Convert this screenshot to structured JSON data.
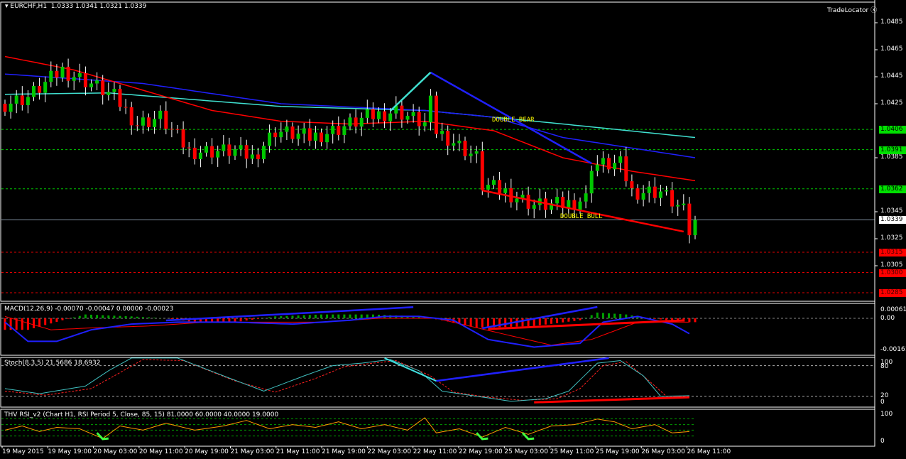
{
  "header": {
    "symbol": "EURCHF,H1",
    "ohlc": "1.0333 1.0341 1.0321 1.0339",
    "brand": "TradeLocator"
  },
  "macd": {
    "title": "MACD(12,26,9) -0.00070 -0.00047 0.00000 -0.00023",
    "ticks": [
      "0.00061",
      "0.00",
      "-0.00161"
    ]
  },
  "stoch": {
    "title": "Stoch(8,3,5) 21.5686 18.6932",
    "ticks": [
      "100",
      "80",
      "20",
      "0"
    ]
  },
  "rsi": {
    "title": "THV RSI_v2  (Chart H1,  RSI Period 5,  Close,  85,  15)  81.0000 60.0000 40.0000 19.0000",
    "ticks": [
      "100",
      "0"
    ]
  },
  "annotations": {
    "bear": "DOUBLE BEAR",
    "bull": "DOUBLE BULL"
  },
  "colors": {
    "up": "#00c800",
    "down": "#ff0000",
    "ma_red": "#ff0000",
    "ma_blue": "#2020ff",
    "ma_cyan": "#40e0d0",
    "support": "#ff0000",
    "resistance": "#00ff00"
  },
  "chart_data": {
    "type": "candlestick",
    "title": "EURCHF,H1",
    "price_ticks": [
      "1.0485",
      "1.0465",
      "1.0445",
      "1.0425",
      "1.0385",
      "1.0345",
      "1.0325",
      "1.0305"
    ],
    "levels": {
      "resistance": [
        "1.0406",
        "1.0391",
        "1.0362"
      ],
      "current": "1.0339",
      "support": [
        "1.0315",
        "1.0300",
        "1.0285"
      ]
    },
    "time_labels": [
      "19 May 2015",
      "19 May 19:00",
      "20 May 03:00",
      "20 May 11:00",
      "20 May 19:00",
      "21 May 03:00",
      "21 May 11:00",
      "21 May 19:00",
      "22 May 03:00",
      "22 May 11:00",
      "22 May 19:00",
      "25 May 03:00",
      "25 May 11:00",
      "25 May 19:00",
      "26 May 03:00",
      "26 May 11:00"
    ],
    "close_path": [
      [
        0,
        1.0425
      ],
      [
        4,
        1.043
      ],
      [
        10,
        1.045
      ],
      [
        15,
        1.044
      ],
      [
        19,
        1.043
      ],
      [
        23,
        1.041
      ],
      [
        27,
        1.0415
      ],
      [
        32,
        1.039
      ],
      [
        40,
        1.039
      ],
      [
        43,
        1.0385
      ],
      [
        47,
        1.0405
      ],
      [
        53,
        1.04
      ],
      [
        57,
        1.0405
      ],
      [
        63,
        1.0415
      ],
      [
        68,
        1.042
      ],
      [
        73,
        1.041
      ],
      [
        74,
        1.0425
      ],
      [
        75,
        1.0405
      ],
      [
        77,
        1.04
      ],
      [
        82,
        1.0385
      ],
      [
        83,
        1.0365
      ],
      [
        87,
        1.036
      ],
      [
        92,
        1.035
      ],
      [
        97,
        1.035
      ],
      [
        101,
        1.0355
      ],
      [
        102,
        1.038
      ],
      [
        107,
        1.038
      ],
      [
        109,
        1.036
      ],
      [
        114,
        1.036
      ],
      [
        118,
        1.0345
      ],
      [
        119,
        1.033
      ],
      [
        120,
        1.0339
      ]
    ],
    "ma_red": [
      [
        0,
        1.046
      ],
      [
        12,
        1.045
      ],
      [
        24,
        1.0435
      ],
      [
        36,
        1.042
      ],
      [
        48,
        1.0412
      ],
      [
        60,
        1.041
      ],
      [
        73,
        1.0412
      ],
      [
        85,
        1.0405
      ],
      [
        97,
        1.0385
      ],
      [
        109,
        1.0375
      ],
      [
        120,
        1.0368
      ]
    ],
    "ma_blue": [
      [
        0,
        1.0447
      ],
      [
        24,
        1.044
      ],
      [
        48,
        1.0425
      ],
      [
        73,
        1.042
      ],
      [
        85,
        1.0415
      ],
      [
        97,
        1.04
      ],
      [
        120,
        1.0385
      ]
    ],
    "ma_cyan": [
      [
        0,
        1.0432
      ],
      [
        18,
        1.0433
      ],
      [
        48,
        1.0423
      ],
      [
        73,
        1.042
      ],
      [
        97,
        1.041
      ],
      [
        120,
        1.04
      ]
    ],
    "trendlines": [
      {
        "color": "#2020ff",
        "from": [
          74,
          1.04482
        ],
        "to": [
          102,
          1.03808
        ]
      },
      {
        "color": "#40e0d0",
        "from": [
          67,
          1.04197
        ],
        "to": [
          74,
          1.04482
        ]
      },
      {
        "color": "#ff0000",
        "from": [
          83,
          1.03608
        ],
        "to": [
          118,
          1.03303
        ]
      },
      {
        "color": "#ff0000",
        "from": [
          83,
          1.0384
        ],
        "to": [
          83,
          1.03608
        ]
      }
    ],
    "macd_main": [
      [
        0,
        -0.0002
      ],
      [
        4,
        -0.0012
      ],
      [
        9,
        -0.0012
      ],
      [
        15,
        -0.0006
      ],
      [
        22,
        -0.0003
      ],
      [
        30,
        -0.0002
      ],
      [
        40,
        -0.0002
      ],
      [
        50,
        -0.0003
      ],
      [
        60,
        -0.0001
      ],
      [
        66,
        0.0001
      ],
      [
        72,
        0.0001
      ],
      [
        78,
        -0.0001
      ],
      [
        84,
        -0.0011
      ],
      [
        92,
        -0.0015
      ],
      [
        100,
        -0.0013
      ],
      [
        104,
        -0.0002
      ],
      [
        110,
        0.0001
      ],
      [
        116,
        -0.0003
      ],
      [
        119,
        -0.0008
      ]
    ],
    "macd_signal": [
      [
        0,
        0.0001
      ],
      [
        8,
        -0.0006
      ],
      [
        15,
        -0.0005
      ],
      [
        25,
        -0.0004
      ],
      [
        35,
        -0.0002
      ],
      [
        45,
        -0.0002
      ],
      [
        55,
        -0.0002
      ],
      [
        65,
        0.0
      ],
      [
        75,
        0.0
      ],
      [
        85,
        -0.0007
      ],
      [
        95,
        -0.0014
      ],
      [
        102,
        -0.0011
      ],
      [
        110,
        -0.0002
      ],
      [
        119,
        -0.0002
      ]
    ],
    "macd_hist": [
      [
        0,
        -0.0006
      ],
      [
        4,
        -0.0006
      ],
      [
        10,
        -0.0001
      ],
      [
        14,
        0.0002
      ],
      [
        22,
        0.0001
      ],
      [
        28,
        0.0
      ],
      [
        33,
        -0.0002
      ],
      [
        40,
        -0.0002
      ],
      [
        47,
        0.0001
      ],
      [
        55,
        0.0002
      ],
      [
        64,
        0.0002
      ],
      [
        72,
        0.0001
      ],
      [
        76,
        -0.0001
      ],
      [
        82,
        -0.0005
      ],
      [
        92,
        -0.0004
      ],
      [
        100,
        -0.0001
      ],
      [
        103,
        0.0003
      ],
      [
        108,
        0.0002
      ],
      [
        112,
        0.0
      ],
      [
        119,
        -0.0002
      ]
    ],
    "stoch_k": [
      [
        0,
        35
      ],
      [
        6,
        25
      ],
      [
        14,
        40
      ],
      [
        18,
        70
      ],
      [
        22,
        95
      ],
      [
        30,
        95
      ],
      [
        38,
        60
      ],
      [
        45,
        30
      ],
      [
        52,
        60
      ],
      [
        57,
        80
      ],
      [
        62,
        85
      ],
      [
        67,
        92
      ],
      [
        72,
        70
      ],
      [
        76,
        30
      ],
      [
        82,
        20
      ],
      [
        88,
        10
      ],
      [
        94,
        15
      ],
      [
        98,
        30
      ],
      [
        103,
        85
      ],
      [
        107,
        90
      ],
      [
        111,
        60
      ],
      [
        114,
        20
      ],
      [
        119,
        21
      ]
    ],
    "stoch_d": [
      [
        0,
        30
      ],
      [
        7,
        22
      ],
      [
        15,
        35
      ],
      [
        19,
        60
      ],
      [
        24,
        92
      ],
      [
        31,
        90
      ],
      [
        40,
        50
      ],
      [
        47,
        28
      ],
      [
        54,
        55
      ],
      [
        59,
        78
      ],
      [
        64,
        85
      ],
      [
        68,
        90
      ],
      [
        74,
        60
      ],
      [
        78,
        28
      ],
      [
        84,
        18
      ],
      [
        90,
        12
      ],
      [
        96,
        15
      ],
      [
        100,
        35
      ],
      [
        104,
        80
      ],
      [
        108,
        88
      ],
      [
        112,
        50
      ],
      [
        115,
        20
      ],
      [
        119,
        19
      ]
    ],
    "rsi": [
      [
        0,
        40
      ],
      [
        3,
        55
      ],
      [
        6,
        35
      ],
      [
        9,
        50
      ],
      [
        13,
        45
      ],
      [
        17,
        10
      ],
      [
        20,
        55
      ],
      [
        24,
        40
      ],
      [
        28,
        65
      ],
      [
        33,
        40
      ],
      [
        38,
        55
      ],
      [
        42,
        75
      ],
      [
        46,
        45
      ],
      [
        50,
        60
      ],
      [
        54,
        50
      ],
      [
        58,
        70
      ],
      [
        62,
        45
      ],
      [
        66,
        60
      ],
      [
        70,
        40
      ],
      [
        73,
        85
      ],
      [
        75,
        30
      ],
      [
        79,
        45
      ],
      [
        83,
        15
      ],
      [
        87,
        50
      ],
      [
        91,
        25
      ],
      [
        95,
        55
      ],
      [
        99,
        60
      ],
      [
        103,
        80
      ],
      [
        106,
        70
      ],
      [
        109,
        45
      ],
      [
        113,
        60
      ],
      [
        116,
        30
      ],
      [
        119,
        35
      ]
    ]
  }
}
